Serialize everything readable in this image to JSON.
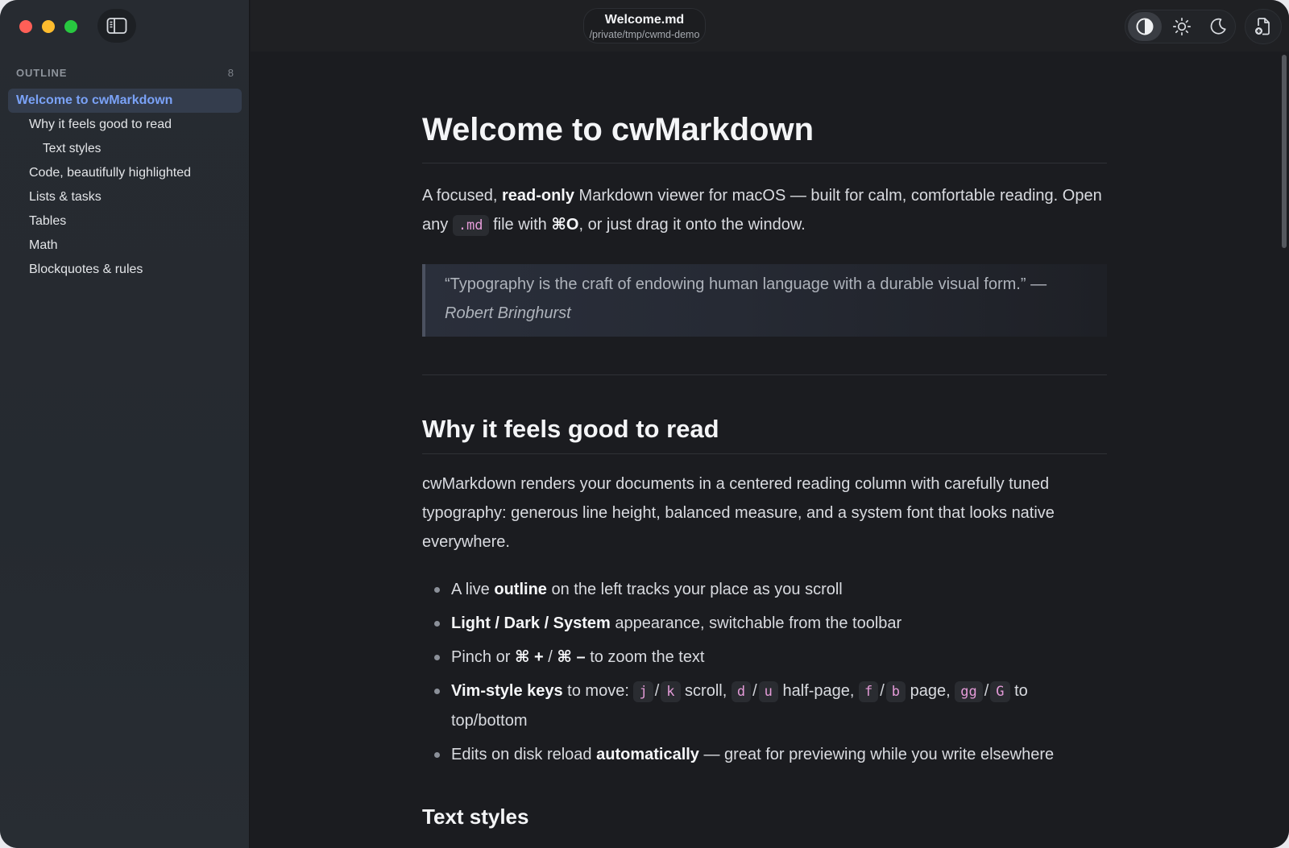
{
  "window": {
    "file_name": "Welcome.md",
    "file_path": "/private/tmp/cwmd-demo"
  },
  "sidebar": {
    "outline_label": "OUTLINE",
    "outline_count": "8",
    "items": [
      {
        "label": "Welcome to cwMarkdown",
        "level": 1,
        "active": true
      },
      {
        "label": "Why it feels good to read",
        "level": 2
      },
      {
        "label": "Text styles",
        "level": 3
      },
      {
        "label": "Code, beautifully highlighted",
        "level": 2
      },
      {
        "label": "Lists & tasks",
        "level": 2
      },
      {
        "label": "Tables",
        "level": 2
      },
      {
        "label": "Math",
        "level": 2
      },
      {
        "label": "Blockquotes & rules",
        "level": 2
      }
    ]
  },
  "toolbar": {
    "icons": [
      "sidebar-toggle-icon",
      "contrast-icon",
      "sun-icon",
      "moon-icon",
      "open-file-icon"
    ],
    "active_appearance": "system"
  },
  "doc": {
    "h1": "Welcome to cwMarkdown",
    "intro": {
      "t1": "A focused, ",
      "b1": "read-only",
      "t2": " Markdown viewer for macOS — built for calm, comfortable reading. Open any ",
      "code1": ".md",
      "t3": " file with ",
      "b2": "⌘O",
      "t4": ", or just drag it onto the window."
    },
    "quote": {
      "text": "“Typography is the craft of endowing human language with a durable visual form.” —",
      "author": "Robert Bringhurst"
    },
    "h2_read": "Why it feels good to read",
    "read_para": "cwMarkdown renders your documents in a centered reading column with carefully tuned typography: generous line height, balanced measure, and a system font that looks native everywhere.",
    "bullets": {
      "b1": {
        "t1": "A live ",
        "b": "outline",
        "t2": " on the left tracks your place as you scroll"
      },
      "b2": {
        "b": "Light / Dark / System",
        "t": " appearance, switchable from the toolbar"
      },
      "b3": {
        "t1": "Pinch or ",
        "b1": "⌘ +",
        "t2": " / ",
        "b2": "⌘ –",
        "t3": " to zoom the text"
      },
      "b4": {
        "b": "Vim-style keys",
        "t1": " to move: ",
        "k1": "j",
        "k2": "k",
        "t2": " scroll, ",
        "k3": "d",
        "k4": "u",
        "t3": " half-page, ",
        "k5": "f",
        "k6": "b",
        "t4": " page, ",
        "k7": "gg",
        "k8": "G",
        "t5": " to top/bottom",
        "slash": "/"
      },
      "b5": {
        "t1": "Edits on disk reload ",
        "b": "automatically",
        "t2": " — great for previewing while you write elsewhere"
      }
    },
    "h3_text_styles": "Text styles"
  }
}
